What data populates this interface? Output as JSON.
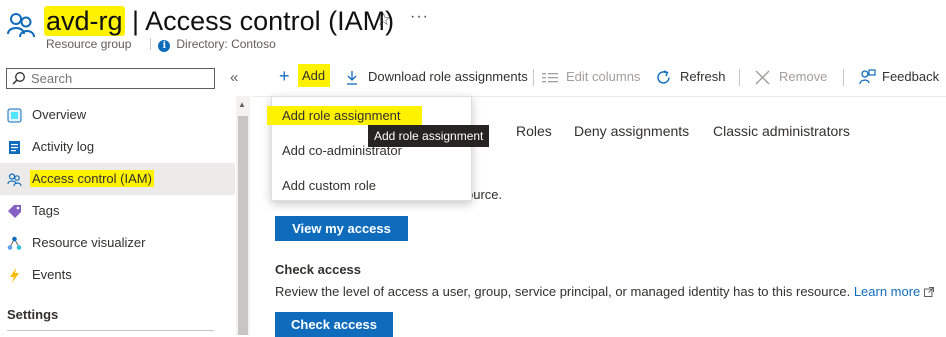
{
  "header": {
    "resource_name": "avd-rg",
    "title_separator": "|",
    "title": "Access control (IAM)",
    "subtitle_type": "Resource group",
    "directory_label": "Directory: Contoso",
    "star_glyph": "☆",
    "more_glyph": "···"
  },
  "search": {
    "placeholder": "Search",
    "collapse_glyph": "«"
  },
  "sidebar": {
    "items": [
      {
        "label": "Overview",
        "icon": "overview-icon"
      },
      {
        "label": "Activity log",
        "icon": "activity-log-icon"
      },
      {
        "label": "Access control (IAM)",
        "icon": "iam-icon",
        "active": true
      },
      {
        "label": "Tags",
        "icon": "tag-icon"
      },
      {
        "label": "Resource visualizer",
        "icon": "resource-visualizer-icon"
      },
      {
        "label": "Events",
        "icon": "events-icon"
      }
    ],
    "section_heading": "Settings"
  },
  "toolbar": {
    "add": "Add",
    "download": "Download role assignments",
    "edit_columns": "Edit columns",
    "refresh": "Refresh",
    "remove": "Remove",
    "feedback": "Feedback"
  },
  "add_menu": {
    "items": [
      "Add role assignment",
      "Add co-administrator",
      "Add custom role"
    ],
    "tooltip": "Add role assignment"
  },
  "tabs": [
    "Roles",
    "Deny assignments",
    "Classic administrators"
  ],
  "content": {
    "my_access_text_tail": "ource.",
    "view_my_access": "View my access",
    "check_access_heading": "Check access",
    "check_access_desc": "Review the level of access a user, group, service principal, or managed identity has to this resource.",
    "learn_more": "Learn more",
    "check_access_button": "Check access"
  },
  "colors": {
    "accent": "#0f6cbd",
    "highlight": "#fff200",
    "active_bg": "#edebe9"
  }
}
